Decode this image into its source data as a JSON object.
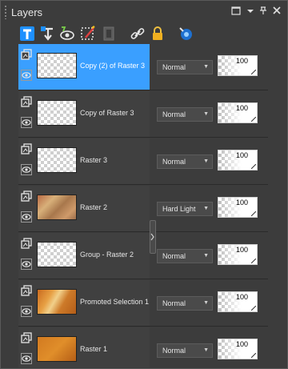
{
  "panel": {
    "title": "Layers"
  },
  "toolbar": {
    "items": [
      "new-raster-layer-icon",
      "new-vector-layer-icon",
      "visibility-toggle-icon",
      "edit-selection-icon",
      "mask-icon",
      "link-icon",
      "lock-icon",
      "palette-menu-icon"
    ]
  },
  "layers": [
    {
      "name": "Copy (2) of Raster 3",
      "blend": "Normal",
      "opacity": "100",
      "selected": true
    },
    {
      "name": "Copy of Raster 3",
      "blend": "Normal",
      "opacity": "100"
    },
    {
      "name": "Raster 3",
      "blend": "Normal",
      "opacity": "100"
    },
    {
      "name": "Raster 2",
      "blend": "Hard Light",
      "opacity": "100"
    },
    {
      "name": "Group - Raster 2",
      "blend": "Normal",
      "opacity": "100"
    },
    {
      "name": "Promoted Selection 1",
      "blend": "Normal",
      "opacity": "100"
    },
    {
      "name": "Raster 1",
      "blend": "Normal",
      "opacity": "100"
    }
  ],
  "colors": {
    "selection": "#3a9fff",
    "panel": "#3c3c3c"
  }
}
